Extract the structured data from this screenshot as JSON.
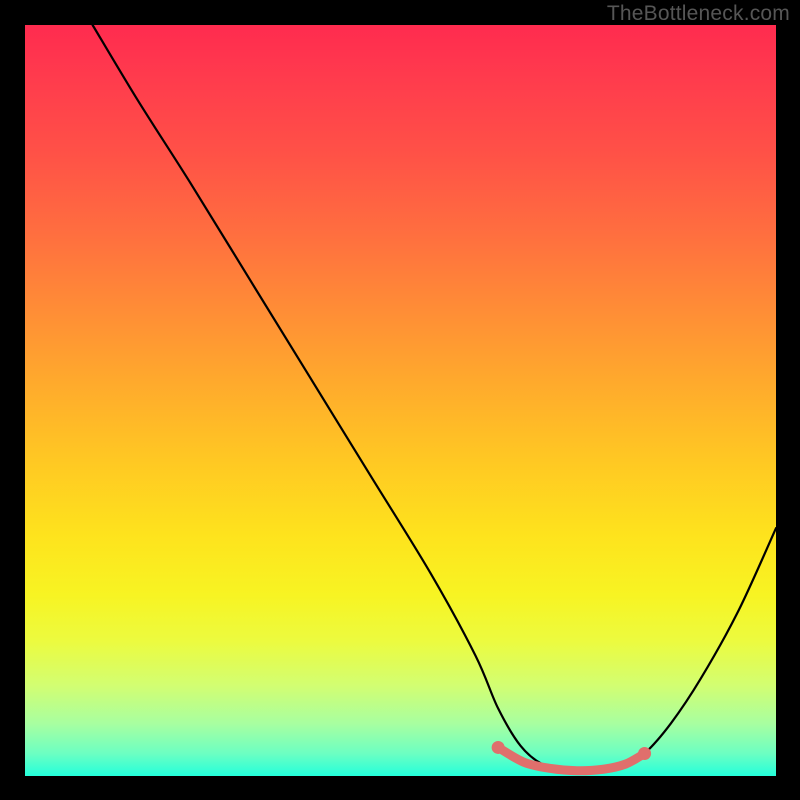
{
  "watermark": "TheBottleneck.com",
  "chart_data": {
    "type": "line",
    "title": "",
    "xlabel": "",
    "ylabel": "",
    "xlim": [
      0,
      100
    ],
    "ylim": [
      0,
      100
    ],
    "grid": false,
    "series": [
      {
        "name": "bottleneck-curve",
        "color": "#000000",
        "x": [
          9,
          15,
          22,
          30,
          38,
          46,
          54,
          60,
          63,
          66,
          69,
          72.5,
          76,
          80,
          82.5,
          86,
          90,
          95,
          100
        ],
        "values": [
          100,
          90,
          79,
          66,
          53,
          40,
          27,
          16,
          9,
          4,
          1.5,
          0.6,
          0.6,
          1.5,
          3,
          7,
          13,
          22,
          33
        ]
      },
      {
        "name": "highlight-green-zone",
        "color": "#e06f6c",
        "x": [
          63,
          66.5,
          70,
          73.5,
          77,
          80,
          82.5
        ],
        "values": [
          3.8,
          1.8,
          1.0,
          0.7,
          0.9,
          1.6,
          3.0
        ]
      }
    ],
    "endpoints": [
      {
        "name": "left-dot",
        "x": 63,
        "y": 3.8,
        "color": "#e06f6c"
      },
      {
        "name": "right-dot",
        "x": 82.5,
        "y": 3.0,
        "color": "#e06f6c"
      }
    ]
  }
}
